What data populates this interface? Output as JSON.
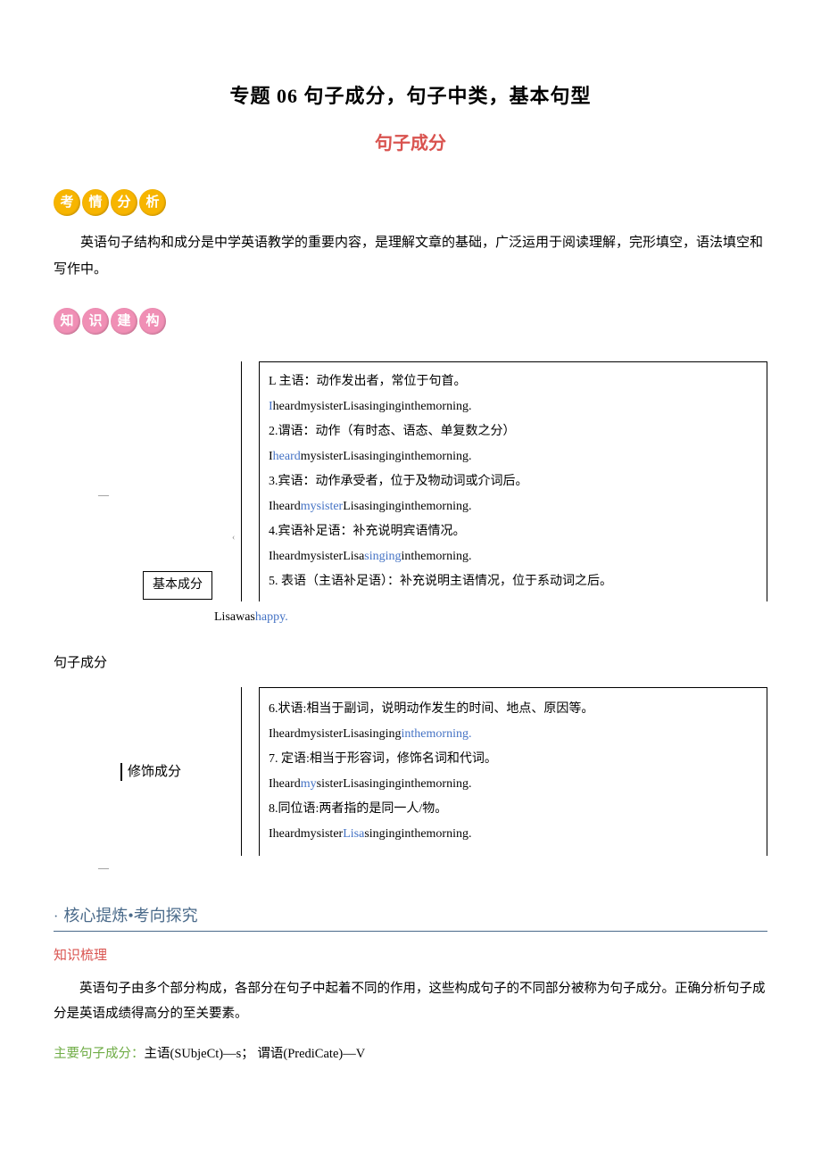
{
  "title": "专题 06 句子成分，句子中类，基本句型",
  "subtitle": "句子成分",
  "badge1": [
    "考",
    "情",
    "分",
    "析"
  ],
  "intro": "英语句子结构和成分是中学英语教学的重要内容，是理解文章的基础，广泛运用于阅读理解，完形填空，语法填空和写作中。",
  "badge2": [
    "知",
    "识",
    "建",
    "构"
  ],
  "block1": {
    "label": "基本成分",
    "items": {
      "l1": "L 主语：动作发出者，常位于句首。",
      "e1a": "I",
      "e1b": "heardmysisterLisasinginginthemorning.",
      "l2": "2.谓语：动作（有时态、语态、单复数之分）",
      "e2a": "I",
      "e2b": "heard",
      "e2c": "mysisterLisasinginginthemorning.",
      "l3": "3.宾语：动作承受者，位于及物动词或介词后。",
      "e3a": "Iheard",
      "e3b": "mysister",
      "e3c": "Lisasinginginthemorning.",
      "l4": "4.宾语补足语：补充说明宾语情况。",
      "e4a": "IheardmysisterLisa",
      "e4b": "singing",
      "e4c": "inthemorning.",
      "l5": "5. 表语（主语补足语）：补充说明主语情况，位于系动词之后。"
    },
    "extra_a": "Lisawas",
    "extra_b": "happy."
  },
  "root_label": "句子成分",
  "block2": {
    "label": "修饰成分",
    "items": {
      "l6": "6.状语:相当于副词，说明动作发生的时间、地点、原因等。",
      "e6a": "IheardmysisterLisasinging",
      "e6b": "inthemorning.",
      "l7": "7. 定语:相当于形容词，修饰名词和代词。",
      "e7a": "Iheard",
      "e7b": "my",
      "e7c": "sisterLisasinginginthemorning.",
      "l8": "8.同位语:两者指的是同一人/物。",
      "e8a": "Iheardmysister",
      "e8b": "Lisa",
      "e8c": "singinginthemorning."
    }
  },
  "heading": {
    "dot": "·",
    "text": "核心提炼•考向探究"
  },
  "red_label": "知识梳理",
  "summary": "英语句子由多个部分构成，各部分在句子中起着不同的作用，这些构成句子的不同部分被称为句子成分。正确分析句子成分是英语成绩得高分的至关要素。",
  "bottom": {
    "prefix": "主要句子成分：",
    "s1": "主语(SUbjeCt)—s；",
    "gap": "        ",
    "s2": "谓语(PrediCate)—V"
  }
}
